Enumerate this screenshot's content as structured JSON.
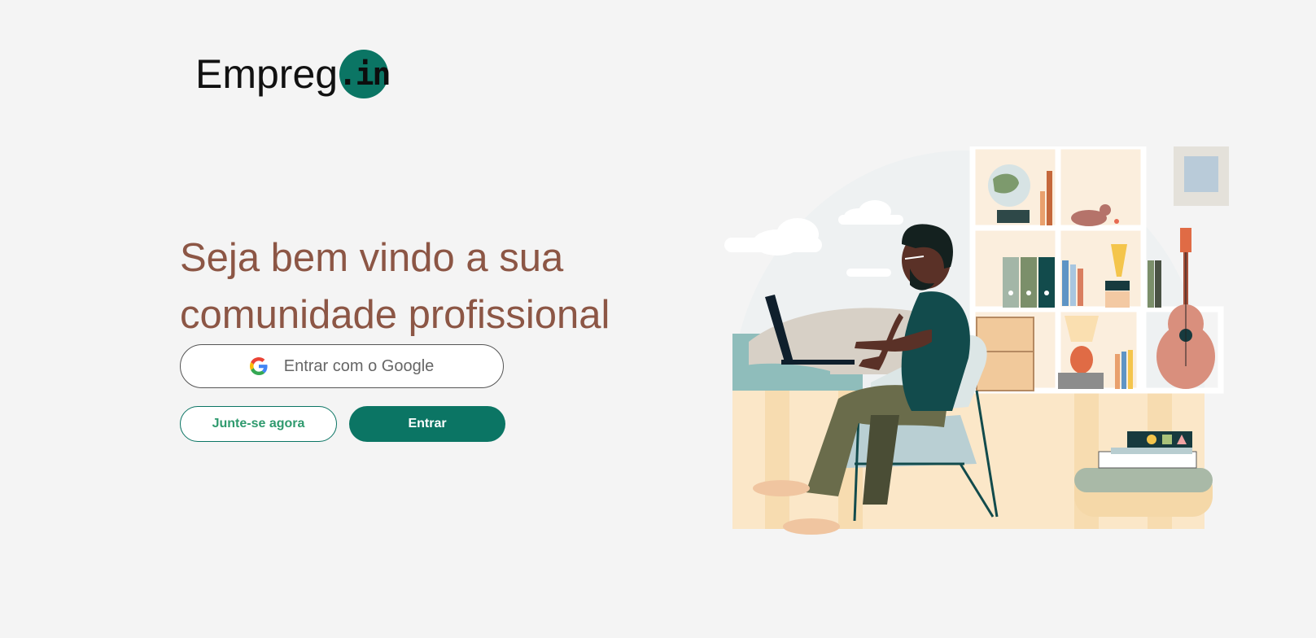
{
  "logo": {
    "text": "Empreg",
    "badge": ".in",
    "badge_color": "#0b7564"
  },
  "hero": {
    "line1": "Seja bem vindo a sua",
    "line2": "comunidade profissional",
    "heading_color": "#8c5645"
  },
  "auth": {
    "google_label": "Entrar com o Google",
    "google_icon": "google-icon",
    "join_label": "Junte-se agora",
    "enter_label": "Entrar"
  },
  "colors": {
    "primary": "#0b7564",
    "background": "#f4f4f4"
  }
}
